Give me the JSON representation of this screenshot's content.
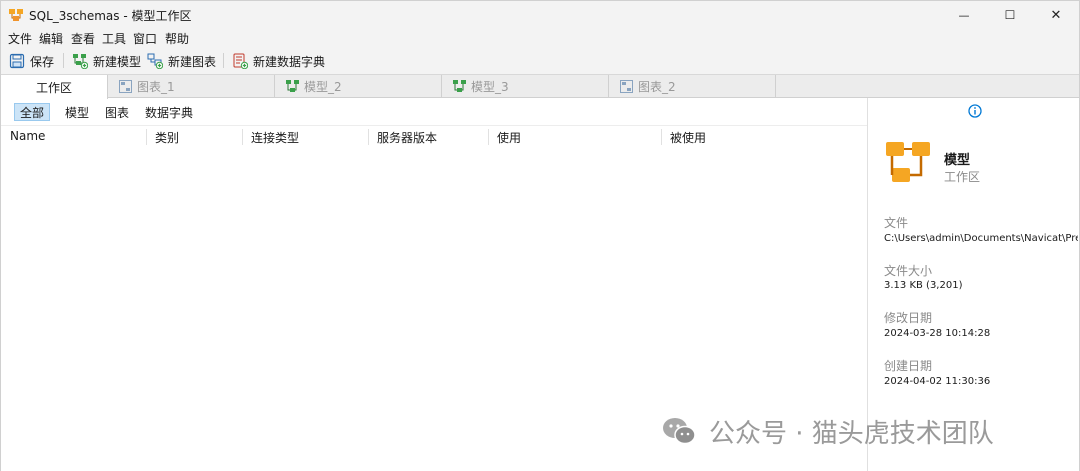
{
  "window": {
    "title": "SQL_3schemas - 模型工作区",
    "controls": {
      "minimize": "—",
      "maximize": "☐",
      "close": "✕"
    }
  },
  "menu": [
    "文件",
    "编辑",
    "查看",
    "工具",
    "窗口",
    "帮助"
  ],
  "toolbar": {
    "save": "保存",
    "new_model": "新建模型",
    "new_diagram": "新建图表",
    "new_dictionary": "新建数据字典"
  },
  "tabs": [
    "工作区",
    "图表_1",
    "模型_2",
    "模型_3",
    "图表_2"
  ],
  "filters": [
    "全部",
    "模型",
    "图表",
    "数据字典"
  ],
  "columns": [
    "Name",
    "类别",
    "连接类型",
    "服务器版本",
    "使用",
    "被使用"
  ],
  "side_panel": {
    "object_name": "模型",
    "object_type": "工作区",
    "file_label": "文件",
    "file_value": "C:\\Users\\admin\\Documents\\Navicat\\Prem",
    "size_label": "文件大小",
    "size_value": "3.13 KB (3,201)",
    "modified_label": "修改日期",
    "modified_value": "2024-03-28 10:14:28",
    "created_label": "创建日期",
    "created_value": "2024-04-02 11:30:36"
  },
  "watermark": "公众号 · 猫头虎技术团队",
  "colors": {
    "accent": "#0078d4",
    "orange": "#f5a623",
    "green": "#3aa04a",
    "selected_bg": "#cce4f7"
  }
}
